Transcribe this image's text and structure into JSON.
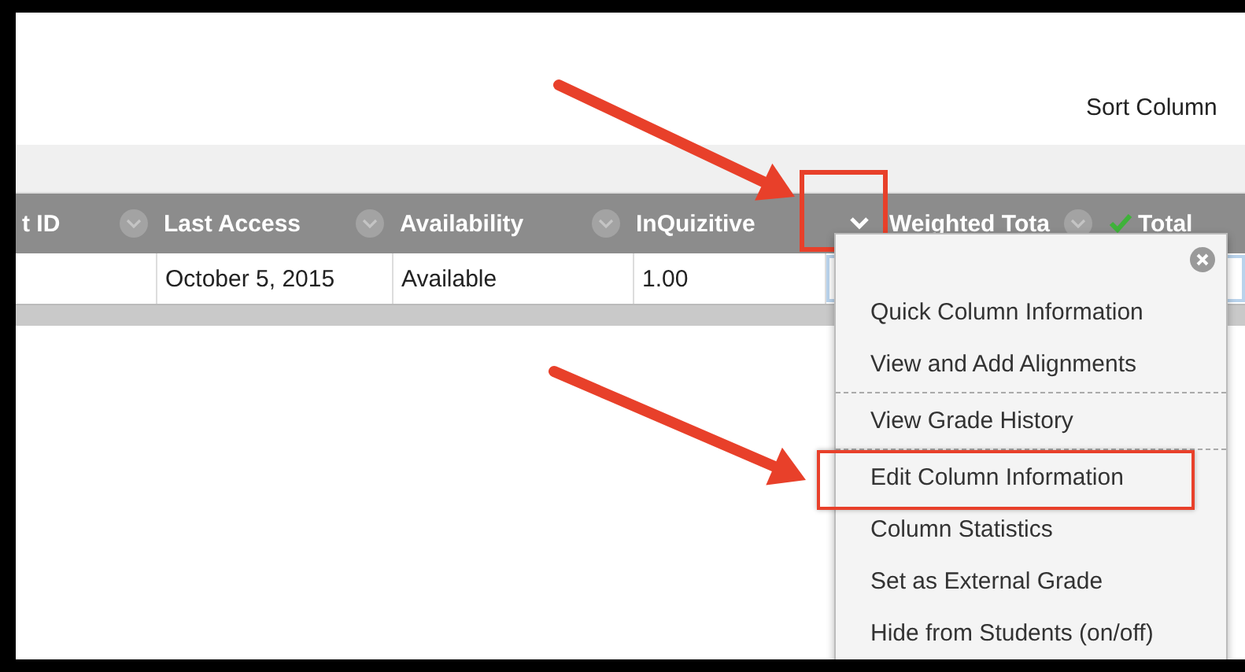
{
  "toolbar": {
    "sort_label": "Sort Column"
  },
  "columns": [
    {
      "label": "t ID",
      "kind": "text",
      "selected": false
    },
    {
      "label": "Last Access",
      "kind": "text",
      "selected": false
    },
    {
      "label": "Availability",
      "kind": "text",
      "selected": false
    },
    {
      "label": "InQuizitive",
      "kind": "text",
      "selected": true
    },
    {
      "label": "Weighted Tota",
      "kind": "text",
      "selected": false
    },
    {
      "label": "Total",
      "kind": "total",
      "selected": false
    }
  ],
  "row": {
    "cells": [
      "October 5, 2015",
      "Available",
      "1.00"
    ]
  },
  "menu": {
    "sections": [
      {
        "items": [
          {
            "label": "Quick Column Information",
            "highlighted": false
          },
          {
            "label": "View and Add Alignments",
            "highlighted": false
          }
        ]
      },
      {
        "items": [
          {
            "label": "View Grade History",
            "highlighted": false
          }
        ]
      },
      {
        "items": [
          {
            "label": "Edit Column Information",
            "highlighted": true
          },
          {
            "label": "Column Statistics",
            "highlighted": false
          },
          {
            "label": "Set as External Grade",
            "highlighted": false
          },
          {
            "label": "Hide from Students (on/off)",
            "highlighted": false
          }
        ]
      }
    ]
  }
}
